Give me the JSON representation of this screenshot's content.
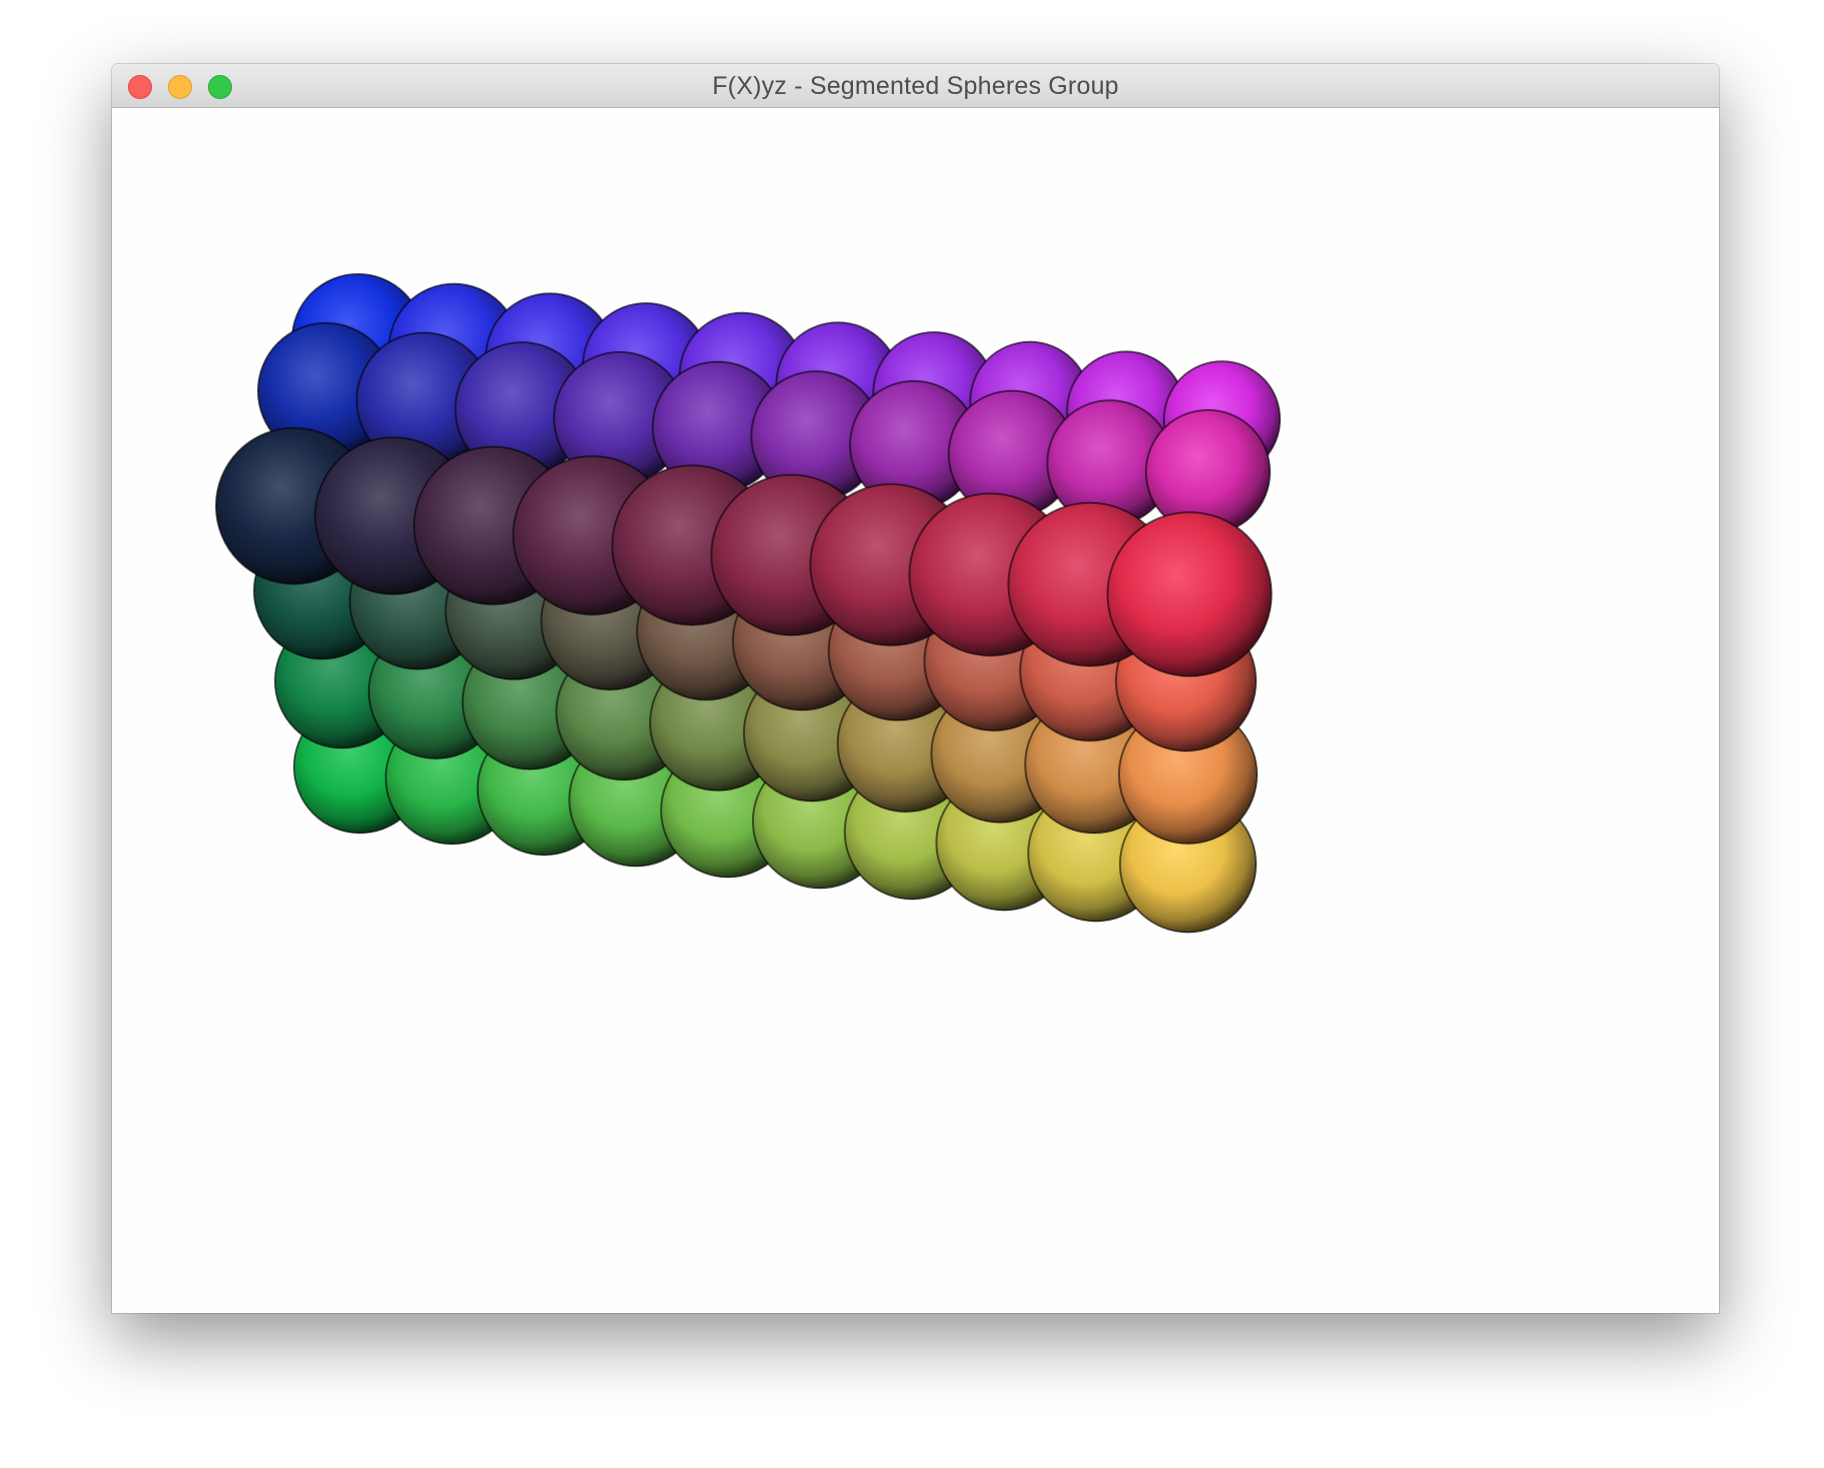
{
  "window": {
    "title": "F(X)yz - Segmented Spheres Group"
  },
  "controls": {
    "close": "close-button",
    "minimize": "minimize-button",
    "zoom": "zoom-button"
  },
  "scene": {
    "object": "segmented-spheres-group",
    "columns": 10,
    "depth_layers": 3,
    "color_gradient": {
      "top_back_left": "#1535f2",
      "top_back_right": "#e22ef0",
      "front_top_left": "#1a2a4a",
      "front_top_right": "#f52f52",
      "bottom_left": "#12c24e",
      "bottom_right": "#ffd14e"
    }
  }
}
